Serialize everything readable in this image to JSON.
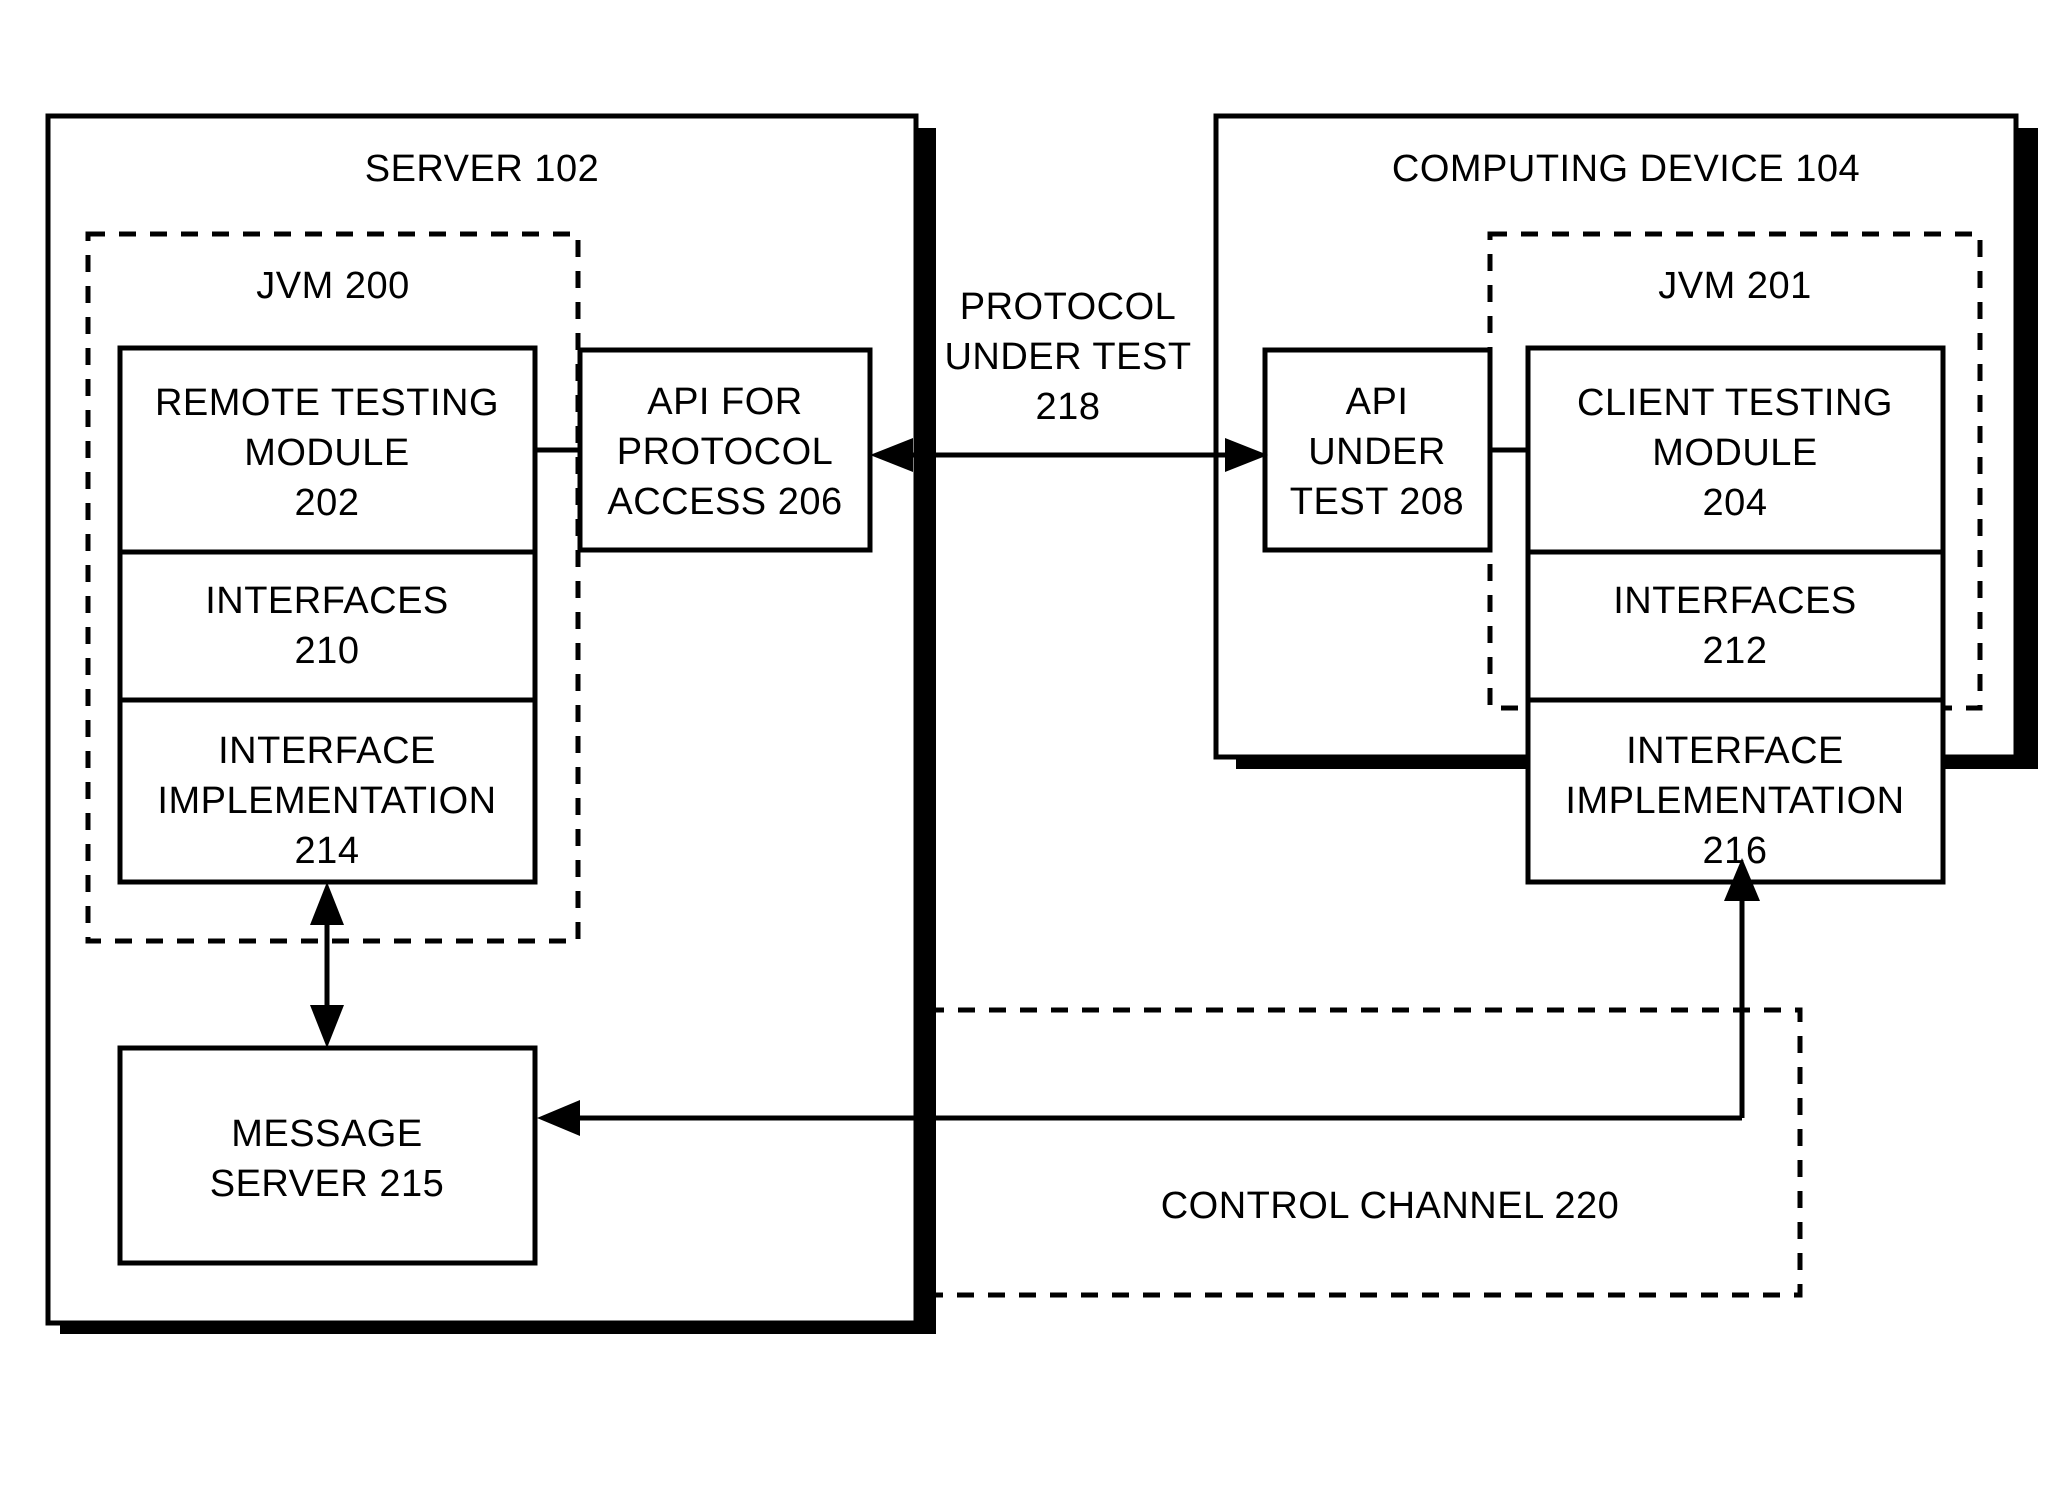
{
  "figure": {
    "type": "patent-block-diagram",
    "background_color": "#ffffff",
    "line_color": "#000000"
  },
  "server_panel": {
    "title": "SERVER  102",
    "jvm": {
      "title": "JVM  200",
      "stack": [
        {
          "line1": "REMOTE TESTING",
          "line2": "MODULE",
          "line3": "202"
        },
        {
          "line1": "INTERFACES",
          "line2": "210",
          "line3": ""
        },
        {
          "line1": "INTERFACE",
          "line2": "IMPLEMENTATION",
          "line3": "214"
        }
      ]
    },
    "api_box": {
      "line1": "API FOR",
      "line2": "PROTOCOL",
      "line3": "ACCESS  206"
    }
  },
  "device_panel": {
    "title": "COMPUTING DEVICE  104",
    "api_under_test": {
      "line1": "API",
      "line2": "UNDER",
      "line3": "TEST 208"
    },
    "jvm": {
      "title": "JVM  201",
      "stack": [
        {
          "line1": "CLIENT TESTING",
          "line2": "MODULE",
          "line3": "204"
        },
        {
          "line1": "INTERFACES",
          "line2": "212",
          "line3": ""
        },
        {
          "line1": "INTERFACE",
          "line2": "IMPLEMENTATION",
          "line3": "216"
        }
      ]
    }
  },
  "protocol_link": {
    "line1": "PROTOCOL",
    "line2": "UNDER TEST",
    "line3": "218"
  },
  "control_channel": {
    "label": "CONTROL CHANNEL 220",
    "message_server": {
      "line1": "MESSAGE",
      "line2": "SERVER 215"
    }
  }
}
